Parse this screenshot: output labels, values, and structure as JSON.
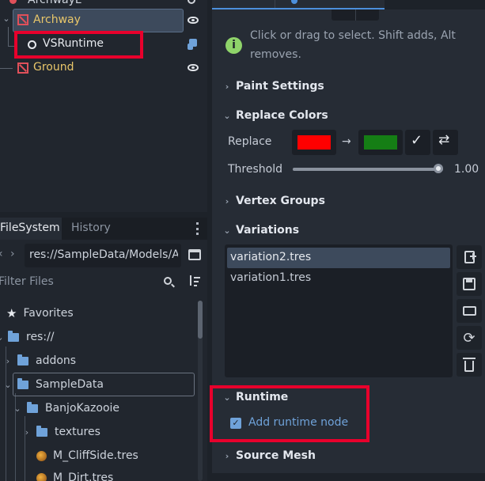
{
  "scene_tree": {
    "partial_top_label": "ArchwayL",
    "nodes": [
      {
        "name": "Archway",
        "color": "#e8c66a"
      },
      {
        "name": "VSRuntime",
        "color": "#e6e9ee"
      },
      {
        "name": "Ground",
        "color": "#e8c66a"
      }
    ]
  },
  "filesystem": {
    "tabs": [
      "FileSystem",
      "History"
    ],
    "path": "res://SampleData/Models/A",
    "filter_placeholder": "Filter Files",
    "items": [
      {
        "label": "Favorites",
        "type": "favorites"
      },
      {
        "label": "res://",
        "type": "folder"
      },
      {
        "label": "addons",
        "type": "folder"
      },
      {
        "label": "SampleData",
        "type": "folder"
      },
      {
        "label": "BanjoKazooie",
        "type": "folder"
      },
      {
        "label": "textures",
        "type": "folder"
      },
      {
        "label": "M_CliffSide.tres",
        "type": "material"
      },
      {
        "label": "M_Dirt.tres",
        "type": "material"
      }
    ]
  },
  "inspector": {
    "info_text_line1": "Click or drag to select. Shift adds, Alt",
    "info_text_line2": "removes.",
    "sections": {
      "paint": "Paint Settings",
      "replace": "Replace Colors",
      "vertex": "Vertex Groups",
      "variations": "Variations",
      "runtime": "Runtime",
      "source": "Source Mesh"
    },
    "replace_label": "Replace",
    "arrow": "→",
    "from_color": "#ff0000",
    "to_color": "#157e15",
    "threshold_label": "Threshold",
    "threshold_value": "1.00",
    "threshold_fraction": 1.0,
    "variations": [
      "variation2.tres",
      "variation1.tres"
    ],
    "runtime_checkbox_label": "Add runtime node",
    "runtime_checked": true
  },
  "colors": {
    "accent": "#4c8fdc",
    "highlight": "#e8002c"
  }
}
